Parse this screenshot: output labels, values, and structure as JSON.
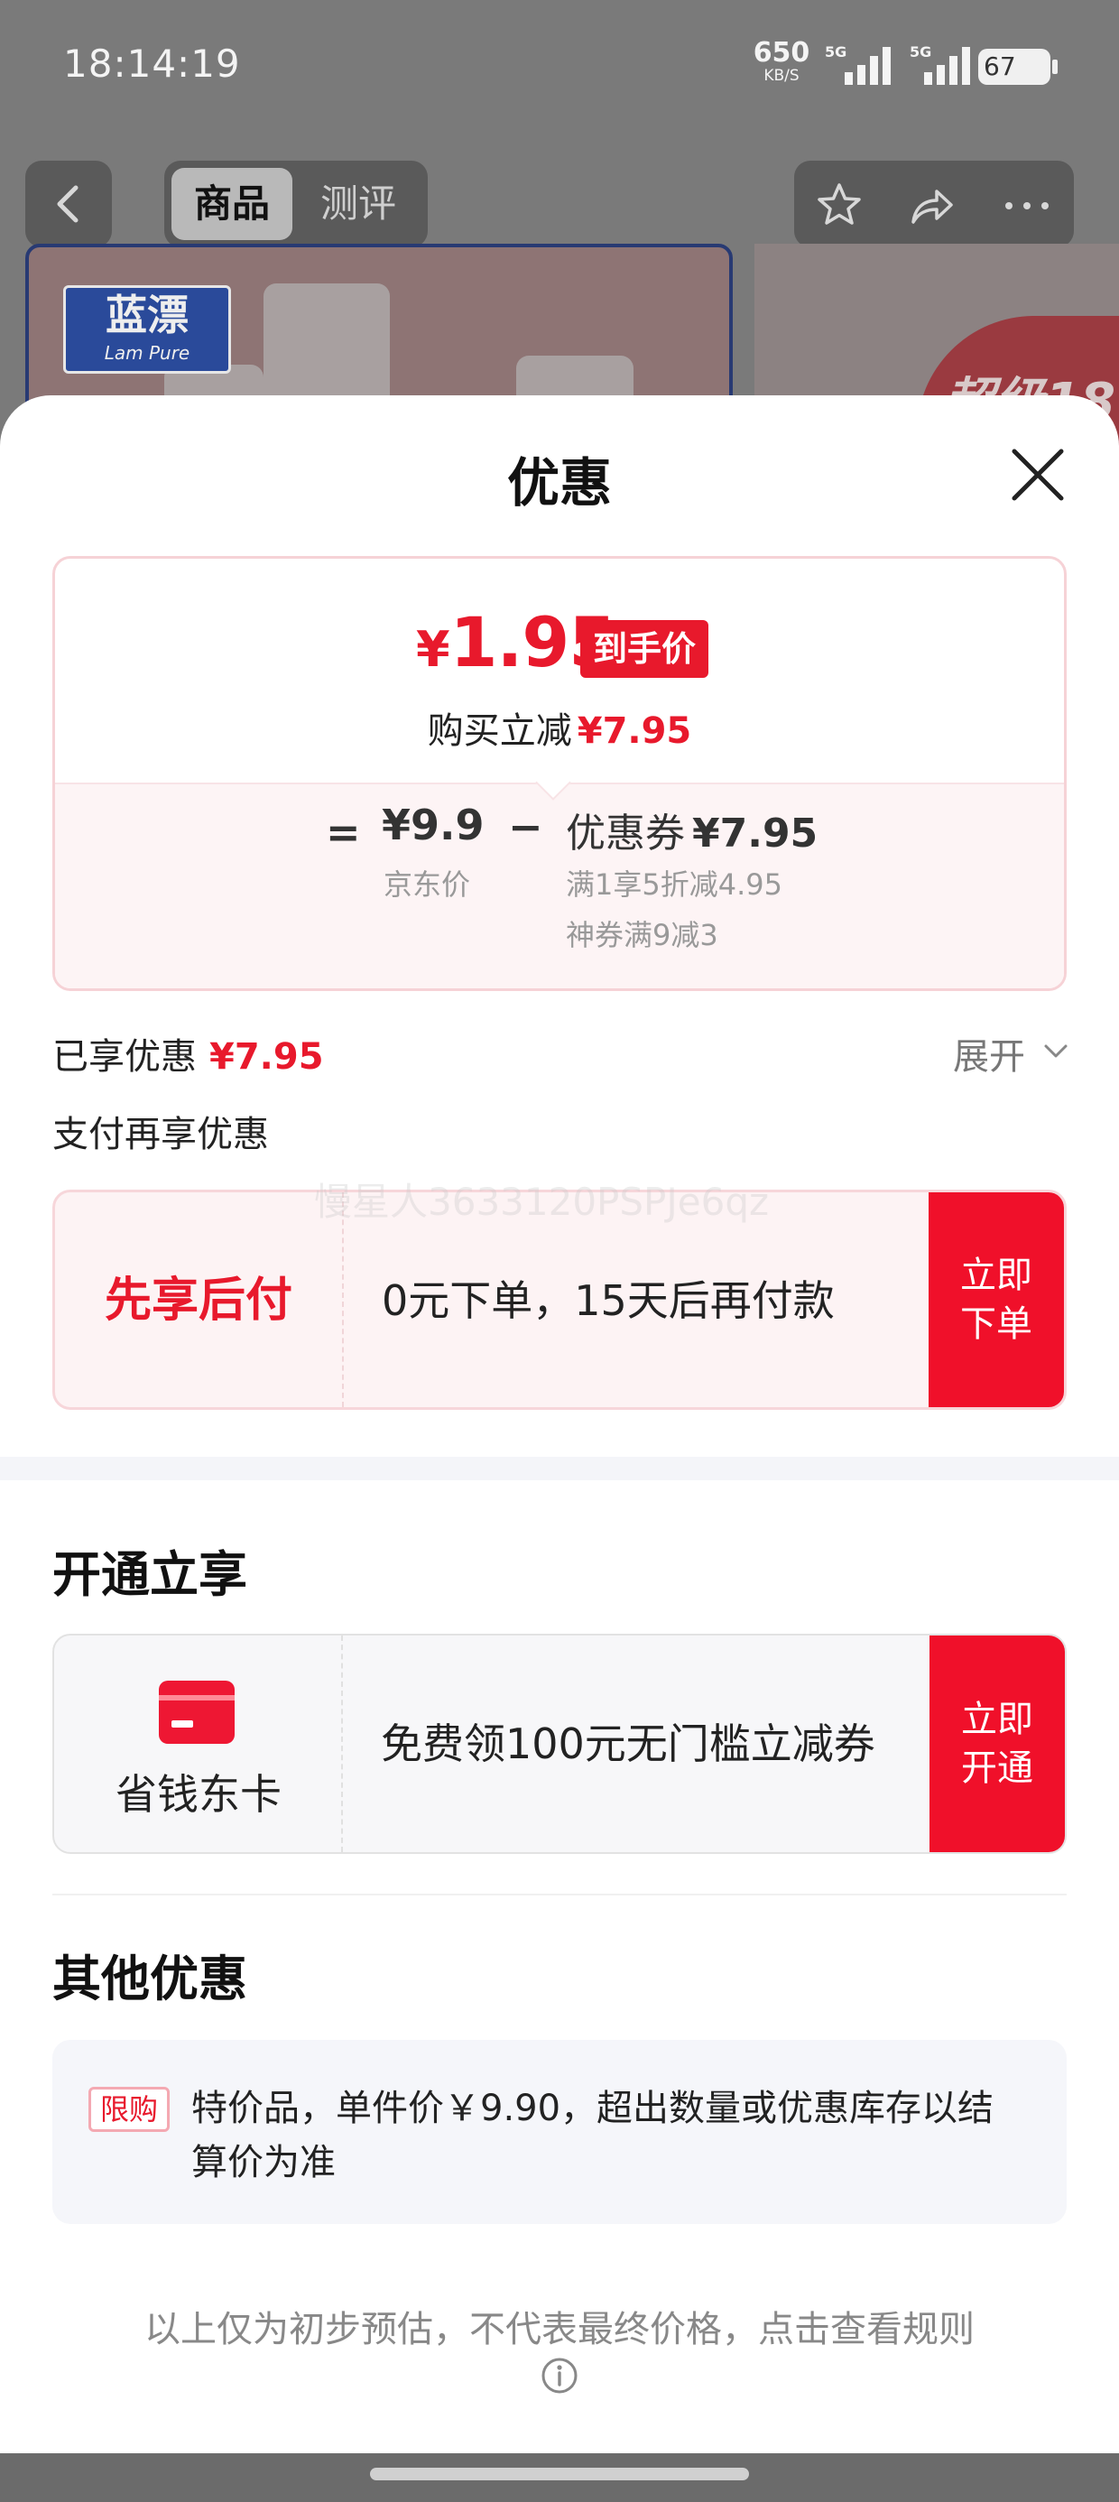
{
  "status_bar": {
    "time": "18:14:19",
    "speed_value": "650",
    "speed_unit": "KB/S",
    "network_1": "5G",
    "network_2": "5G",
    "battery": "67"
  },
  "nav": {
    "tabs": [
      {
        "label": "商品",
        "active": true
      },
      {
        "label": "测评",
        "active": false
      }
    ],
    "icons": [
      "back-icon",
      "star-icon",
      "share-icon",
      "more-icon"
    ]
  },
  "product_banner": {
    "brand_cn": "蓝漂",
    "brand_en": "Lam Pure",
    "promo_text": "超级18"
  },
  "sheet": {
    "title": "优惠",
    "price_card": {
      "final_price_symbol": "¥",
      "final_price": "1.95",
      "price_tag": "到手价",
      "reduce_label": "购买立减",
      "reduce_value": "¥7.95",
      "equals": "=",
      "jd_price": "¥9.9",
      "jd_label": "京东价",
      "minus": "−",
      "coupon_label": "优惠券",
      "coupon_value": "¥7.95",
      "coupon_details": [
        "满1享5折减4.95",
        "神券满9减3"
      ]
    },
    "enjoyed_label": "已享优惠",
    "enjoyed_value": "¥7.95",
    "expand_label": "展开",
    "pay_more_label": "支付再享优惠",
    "bnpl": {
      "title": "先享后付",
      "desc": "0元下单，15天后再付款",
      "button": "立即下单"
    },
    "watermark": "慢星人3633120PSPJe6qz",
    "open_section": {
      "title": "开通立享",
      "card_name": "省钱东卡",
      "desc": "免费领100元无门槛立减券",
      "button": "立即开通"
    },
    "other_section": {
      "title": "其他优惠",
      "badge": "限购",
      "text": "特价品，单件价￥9.90，超出数量或优惠库存以结算价为准"
    },
    "footer_note": "以上仅为初步预估，不代表最终价格，点击查看规则"
  },
  "colors": {
    "accent_red": "#e8192c",
    "button_red": "#f0102a"
  }
}
